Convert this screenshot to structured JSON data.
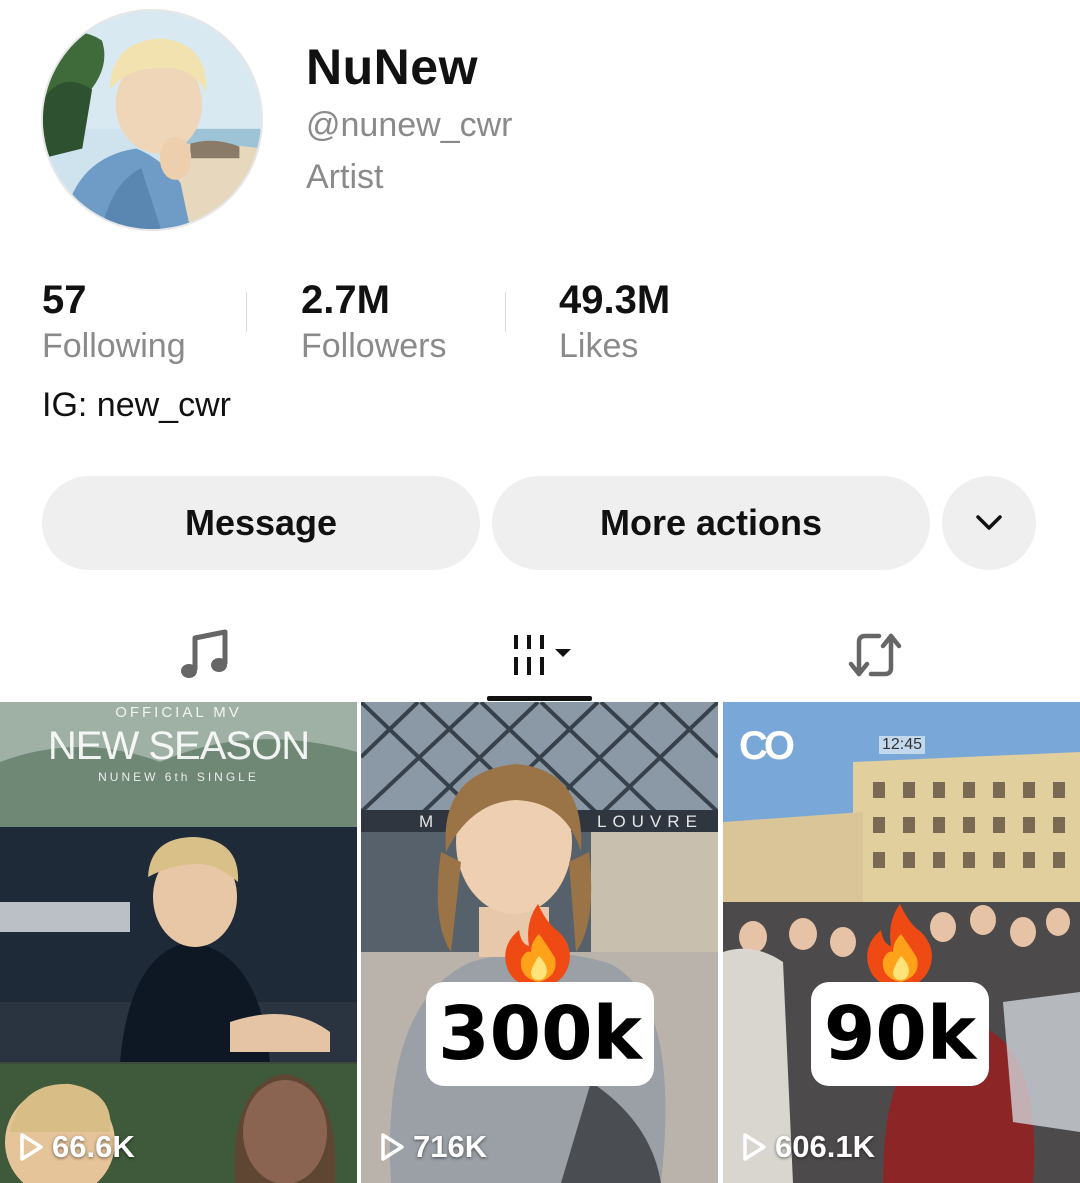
{
  "profile": {
    "name": "NuNew",
    "handle": "@nunew_cwr",
    "category": "Artist",
    "bio": "IG: new_cwr"
  },
  "stats": {
    "following": {
      "value": "57",
      "label": "Following"
    },
    "followers": {
      "value": "2.7M",
      "label": "Followers"
    },
    "likes": {
      "value": "49.3M",
      "label": "Likes"
    }
  },
  "actions": {
    "message": "Message",
    "more": "More actions",
    "expand_icon": "chevron-down-icon"
  },
  "tabs": {
    "music_icon": "music-note-icon",
    "videos_icon": "grid-sort-icon",
    "reposts_icon": "repost-icon",
    "active": "videos"
  },
  "videos": [
    {
      "views": "66.6K",
      "title_small": "OFFICIAL MV",
      "title_big": "NEW SEASON",
      "subtitle": "NUNEW 6th SINGLE"
    },
    {
      "views": "716K",
      "overlay": "300k",
      "sign": "LOUVRE",
      "sign_fragment": "M"
    },
    {
      "views": "606.1K",
      "overlay": "90k",
      "clock": "12:45",
      "logo": "CO"
    }
  ]
}
